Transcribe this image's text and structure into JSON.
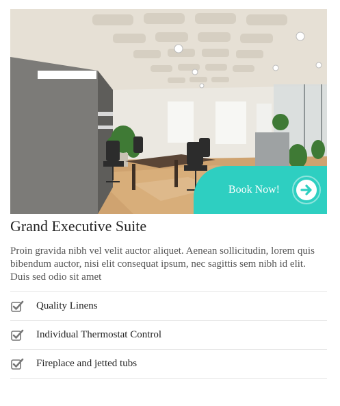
{
  "room": {
    "title": "Grand Executive Suite",
    "description": "Proin gravida nibh vel velit auctor aliquet. Aenean sollicitudin, lorem quis bibendum auctor, nisi elit consequat ipsum, nec sagittis sem nibh id elit. Duis sed odio sit amet",
    "book_label": "Book Now!",
    "book_icon": "arrow-right-circle-icon",
    "features": [
      {
        "label": "Quality Linens",
        "icon": "checkbox-checked-icon"
      },
      {
        "label": "Individual Thermostat Control",
        "icon": "checkbox-checked-icon"
      },
      {
        "label": "Fireplace and jetted tubs",
        "icon": "checkbox-checked-icon"
      }
    ]
  },
  "colors": {
    "accent": "#2ecfc1",
    "text": "#222222",
    "muted_text": "#555555",
    "divider": "#e6e6e6",
    "icon": "#777777"
  }
}
